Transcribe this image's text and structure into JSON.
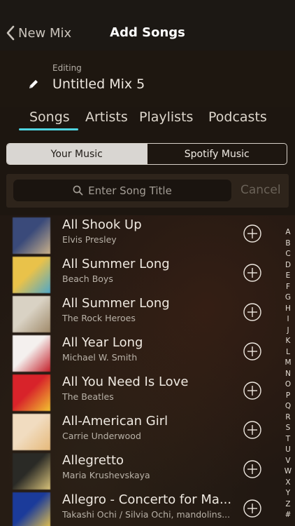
{
  "nav": {
    "back_label": "New Mix",
    "title": "Add Songs"
  },
  "editing": {
    "label": "Editing",
    "mix_name": "Untitled Mix 5"
  },
  "tabs": [
    {
      "label": "Songs",
      "active": true
    },
    {
      "label": "Artists",
      "active": false
    },
    {
      "label": "Playlists",
      "active": false
    },
    {
      "label": "Podcasts",
      "active": false
    }
  ],
  "source_toggle": {
    "options": [
      "Your Music",
      "Spotify Music"
    ],
    "selected": "Your Music"
  },
  "search": {
    "placeholder": "Enter Song Title",
    "cancel_label": "Cancel"
  },
  "songs": [
    {
      "title": "All Shook Up",
      "artist": "Elvis Presley",
      "art_colors": [
        "#3a4a7a",
        "#c9b08a"
      ]
    },
    {
      "title": "All Summer Long",
      "artist": "Beach Boys",
      "art_colors": [
        "#e9c24a",
        "#4fa8c9"
      ]
    },
    {
      "title": "All Summer Long",
      "artist": "The Rock Heroes",
      "art_colors": [
        "#d9d2c4",
        "#a08a6a"
      ]
    },
    {
      "title": "All Year Long",
      "artist": "Michael W. Smith",
      "art_colors": [
        "#f4f0ee",
        "#c4202a"
      ]
    },
    {
      "title": "All You Need Is Love",
      "artist": "The Beatles",
      "art_colors": [
        "#d8232a",
        "#f2c230"
      ]
    },
    {
      "title": "All-American Girl",
      "artist": "Carrie Underwood",
      "art_colors": [
        "#f1dcc0",
        "#e6b97a"
      ]
    },
    {
      "title": "Allegretto",
      "artist": "Maria Krushevskaya",
      "art_colors": [
        "#2a2a26",
        "#d8c27a"
      ]
    },
    {
      "title": "Allegro - Concerto for Ma...",
      "artist": "Takashi Ochi / Silvia Ochi, mandolins...",
      "art_colors": [
        "#1b3b9a",
        "#e6c24a"
      ]
    }
  ],
  "index_letters": [
    "A",
    "B",
    "C",
    "D",
    "E",
    "F",
    "G",
    "H",
    "I",
    "J",
    "K",
    "L",
    "M",
    "N",
    "O",
    "P",
    "Q",
    "R",
    "S",
    "T",
    "U",
    "V",
    "W",
    "X",
    "Y",
    "Z",
    "#"
  ],
  "colors": {
    "accent": "#4fd4e0",
    "background": "#1d1610"
  }
}
